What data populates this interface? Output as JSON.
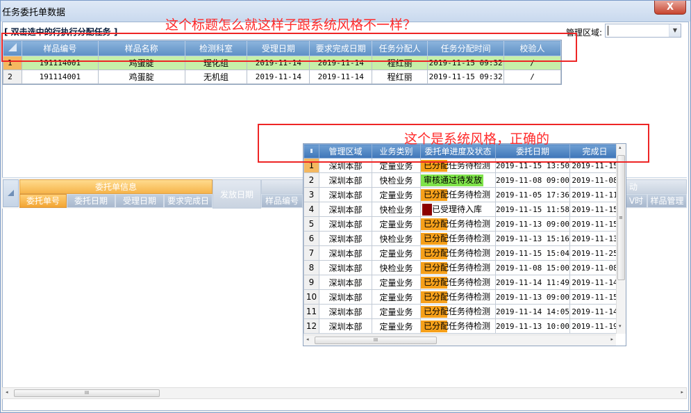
{
  "window": {
    "title": "任务委托单数据",
    "close_glyph": "X"
  },
  "hint": "[ 双击选中的行执行分配任务 ]",
  "annotations": {
    "top": "这个标题怎么就这样子跟系统风格不一样？",
    "mid": "这个是系统风格，正确的"
  },
  "filter": {
    "label": "管理区域:",
    "value": ""
  },
  "grid1": {
    "columns": [
      "样品编号",
      "样品名称",
      "检测科室",
      "受理日期",
      "要求完成日期",
      "任务分配人",
      "任务分配时间",
      "校验人"
    ],
    "rows": [
      {
        "rn": "1",
        "cells": [
          "191114001",
          "鸡蛋腚",
          "理化组",
          "2019-11-14",
          "2019-11-14",
          "程红丽",
          "2019-11-15 09:32",
          "/"
        ],
        "selected": true
      },
      {
        "rn": "2",
        "cells": [
          "191114001",
          "鸡蛋腚",
          "无机组",
          "2019-11-14",
          "2019-11-14",
          "程红丽",
          "2019-11-15 09:32",
          "/"
        ],
        "selected": false
      }
    ]
  },
  "lower": {
    "groups": {
      "info": "委托单信息",
      "ship": "发放日期",
      "tail": "动"
    },
    "subheaders": [
      "委托单号",
      "委托日期",
      "受理日期",
      "要求完成日",
      "样品编号",
      "V时",
      "样品管理"
    ]
  },
  "grid2": {
    "columns": [
      "管理区域",
      "业务类别",
      "委托单进度及状态",
      "委托日期",
      "完成日"
    ],
    "rows": [
      {
        "rn": "1",
        "area": "深圳本部",
        "type": "定量业务",
        "status": "已分配任务待检测",
        "status_kind": "orange",
        "date": "2019-11-15 13:50",
        "done": "2019-11-15",
        "selected": true
      },
      {
        "rn": "2",
        "area": "深圳本部",
        "type": "快检业务",
        "status": "审核通过待发放",
        "status_kind": "green",
        "date": "2019-11-08 09:00",
        "done": "2019-11-08",
        "selected": false
      },
      {
        "rn": "3",
        "area": "深圳本部",
        "type": "定量业务",
        "status": "已分配任务待检测",
        "status_kind": "orange",
        "date": "2019-11-05 17:36",
        "done": "2019-11-11",
        "selected": false
      },
      {
        "rn": "4",
        "area": "深圳本部",
        "type": "快检业务",
        "status": "已受理待入库",
        "status_kind": "darkred",
        "date": "2019-11-15 11:58",
        "done": "2019-11-15",
        "selected": false
      },
      {
        "rn": "5",
        "area": "深圳本部",
        "type": "定量业务",
        "status": "已分配任务待检测",
        "status_kind": "orange",
        "date": "2019-11-13 09:00",
        "done": "2019-11-15",
        "selected": false
      },
      {
        "rn": "6",
        "area": "深圳本部",
        "type": "快检业务",
        "status": "已分配任务待检测",
        "status_kind": "orange",
        "date": "2019-11-13 15:16",
        "done": "2019-11-13",
        "selected": false
      },
      {
        "rn": "7",
        "area": "深圳本部",
        "type": "定量业务",
        "status": "已分配任务待检测",
        "status_kind": "orange",
        "date": "2019-11-15 15:04",
        "done": "2019-11-25",
        "selected": false
      },
      {
        "rn": "8",
        "area": "深圳本部",
        "type": "快检业务",
        "status": "已分配任务待检测",
        "status_kind": "orange",
        "date": "2019-11-08 15:00",
        "done": "2019-11-08",
        "selected": false
      },
      {
        "rn": "9",
        "area": "深圳本部",
        "type": "定量业务",
        "status": "已分配任务待检测",
        "status_kind": "orange",
        "date": "2019-11-14 11:49",
        "done": "2019-11-14",
        "selected": false
      },
      {
        "rn": "10",
        "area": "深圳本部",
        "type": "定量业务",
        "status": "已分配任务待检测",
        "status_kind": "orange",
        "date": "2019-11-13 09:00",
        "done": "2019-11-15",
        "selected": false
      },
      {
        "rn": "11",
        "area": "深圳本部",
        "type": "定量业务",
        "status": "已分配任务待检测",
        "status_kind": "orange",
        "date": "2019-11-14 14:05",
        "done": "2019-11-14",
        "selected": false
      },
      {
        "rn": "12",
        "area": "深圳本部",
        "type": "定量业务",
        "status": "已分配任务待检测",
        "status_kind": "orange",
        "date": "2019-11-13 10:00",
        "done": "2019-11-19",
        "selected": false
      }
    ]
  },
  "status_colors": {
    "orange": "#f6a01a",
    "green": "#7fe34a",
    "darkred": "#8b0000"
  },
  "scroll_glyphs": {
    "grip": "III",
    "left": "◂",
    "right": "▸",
    "up": "▴",
    "down": "▾",
    "mid": "≡",
    "combo": "▼"
  }
}
